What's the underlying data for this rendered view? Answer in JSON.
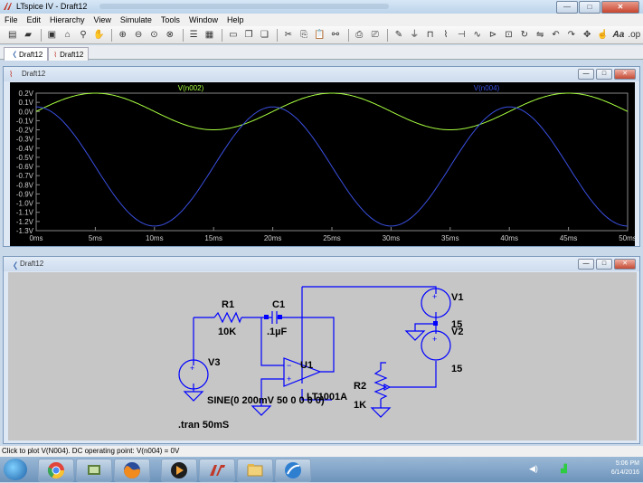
{
  "window": {
    "title": "LTspice IV - Draft12",
    "buttons": {
      "minimize": "—",
      "maximize": "□",
      "close": "✕"
    }
  },
  "menu": [
    "File",
    "Edit",
    "Hierarchy",
    "View",
    "Simulate",
    "Tools",
    "Window",
    "Help"
  ],
  "toolbar_icons": [
    "new-schematic-icon",
    "open-icon",
    "save-icon",
    "control-panel-icon",
    "run-icon",
    "halt-icon",
    "pan-icon",
    "zoom-in-icon",
    "zoom-out-icon",
    "zoom-fit-icon",
    "zoom-cancel-icon",
    "autoscale-icon",
    "split-icon",
    "tile-horizontal-icon",
    "cascade-icon",
    "close-all-icon",
    "cut-icon",
    "copy-icon",
    "paste-icon",
    "find-icon",
    "print-icon",
    "print-setup-icon",
    "wire-icon",
    "ground-icon",
    "label-icon",
    "resistor-icon",
    "capacitor-icon",
    "inductor-icon",
    "diode-icon",
    "component-icon",
    "rotate-icon",
    "mirror-icon",
    "undo-icon",
    "redo-icon",
    "move-icon",
    "drag-icon",
    "text-icon",
    "spice-directive-icon"
  ],
  "tabs": [
    {
      "label": "Draft12",
      "icon": "schematic-icon"
    },
    {
      "label": "Draft12",
      "icon": "waveform-icon"
    }
  ],
  "waveform_window": {
    "title": "Draft12",
    "buttons": {
      "minimize": "—",
      "maximize": "□",
      "close": "✕"
    }
  },
  "schematic_window": {
    "title": "Draft12",
    "buttons": {
      "minimize": "—",
      "maximize": "□",
      "close": "✕"
    }
  },
  "chart_data": {
    "type": "line",
    "xlabel": "",
    "ylabel": "",
    "xlim": [
      0,
      50
    ],
    "ylim": [
      -1.3,
      0.2
    ],
    "x_ticks": [
      "0ms",
      "5ms",
      "10ms",
      "15ms",
      "20ms",
      "25ms",
      "30ms",
      "35ms",
      "40ms",
      "45ms",
      "50ms"
    ],
    "y_ticks": [
      "0.2V",
      "0.1V",
      "0.0V",
      "-0.1V",
      "-0.2V",
      "-0.3V",
      "-0.4V",
      "-0.5V",
      "-0.6V",
      "-0.7V",
      "-0.8V",
      "-0.9V",
      "-1.0V",
      "-1.1V",
      "-1.2V",
      "-1.3V"
    ],
    "grid": false,
    "series": [
      {
        "name": "V(n002)",
        "color": "#a8ff40",
        "offset": 0.0,
        "amplitude": 0.2,
        "period_ms": 20,
        "phase": "sin"
      },
      {
        "name": "V(n004)",
        "color": "#3a4fe0",
        "offset": -0.6,
        "amplitude": 0.65,
        "period_ms": 20,
        "phase": "cos"
      }
    ]
  },
  "schematic": {
    "R1": {
      "name": "R1",
      "value": "10K"
    },
    "C1": {
      "name": "C1",
      "value": ".1µF"
    },
    "U1": {
      "name": "U1",
      "value": "LT1001A"
    },
    "V1": {
      "name": "V1",
      "value": "15"
    },
    "V2": {
      "name": "V2",
      "value": "15"
    },
    "V3": {
      "name": "V3",
      "value": "SINE(0 200mV 50 0 0 0 0)"
    },
    "R2": {
      "name": "R2",
      "value": "1K"
    },
    "directive": ".tran 50mS"
  },
  "status_bar": "Click to plot V(N004).  DC operating point: V(n004) = 0V",
  "taskbar": {
    "time": "5:06 PM",
    "date": "6/14/2016"
  }
}
